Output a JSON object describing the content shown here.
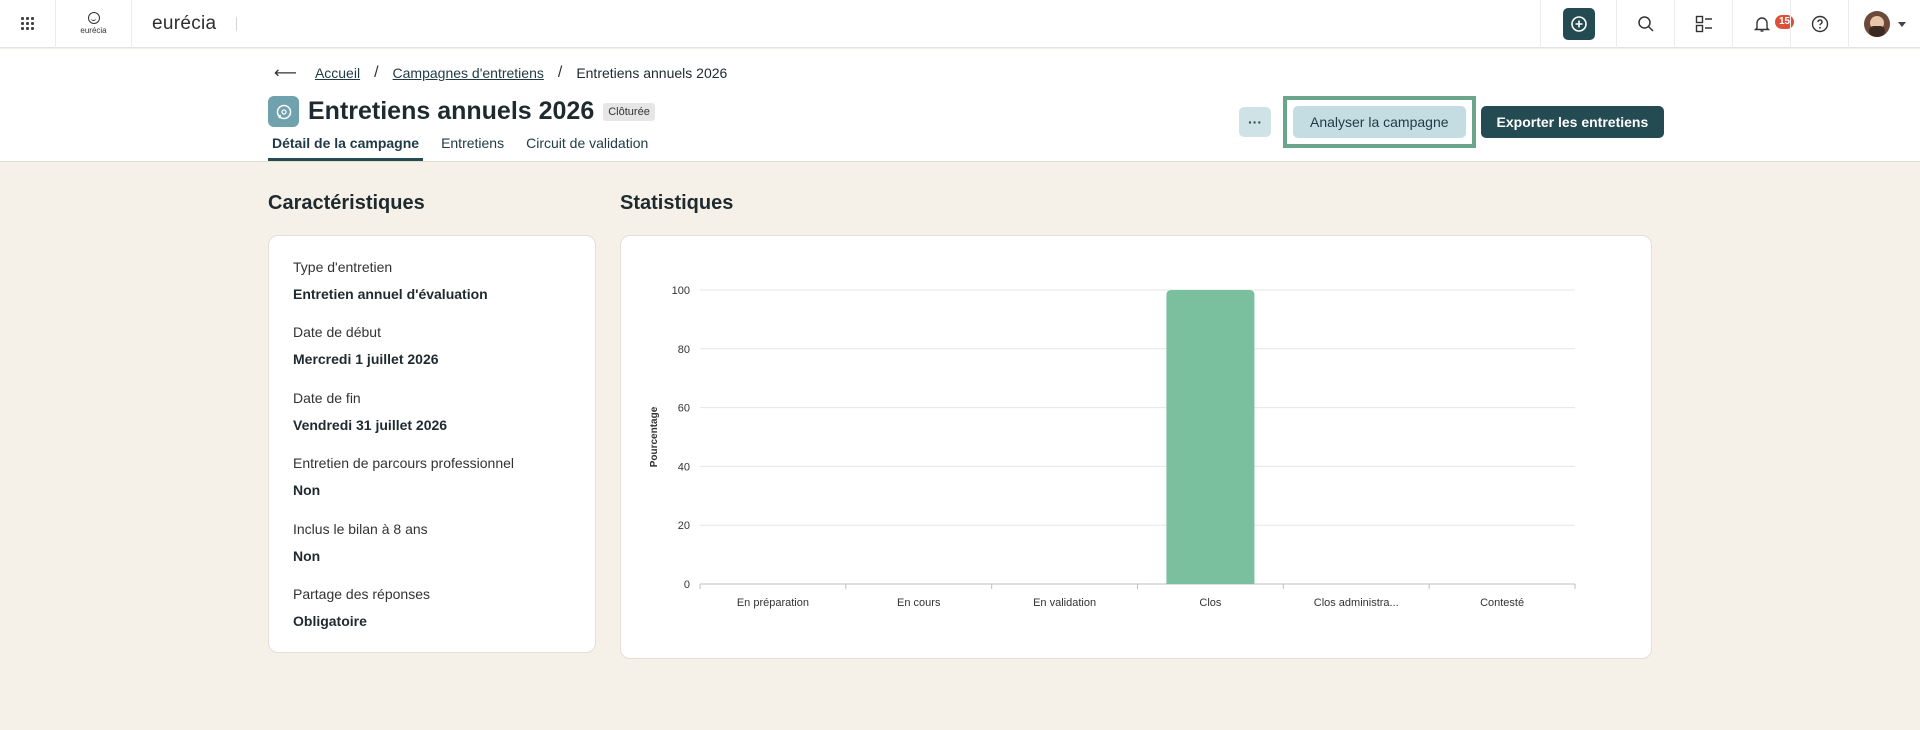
{
  "topbar": {
    "logo_small_text": "eurécia",
    "brand": "eurécia",
    "notifications_count": "15"
  },
  "breadcrumb": {
    "items": [
      "Accueil",
      "Campagnes d'entretiens",
      "Entretiens annuels 2026"
    ]
  },
  "page": {
    "title": "Entretiens annuels 2026",
    "status": "Clôturée",
    "more_label": "···",
    "analyse_label": "Analyser la campagne",
    "export_label": "Exporter les entretiens"
  },
  "tabs": [
    "Détail de la campagne",
    "Entretiens",
    "Circuit de validation"
  ],
  "characteristics": {
    "title": "Caractéristiques",
    "fields": [
      {
        "label": "Type d'entretien",
        "value": "Entretien annuel d'évaluation"
      },
      {
        "label": "Date de début",
        "value": "Mercredi 1 juillet 2026"
      },
      {
        "label": "Date de fin",
        "value": "Vendredi 31 juillet 2026"
      },
      {
        "label": "Entretien de parcours professionnel",
        "value": "Non"
      },
      {
        "label": "Inclus le bilan à 8 ans",
        "value": "Non"
      },
      {
        "label": "Partage des réponses",
        "value": "Obligatoire"
      }
    ]
  },
  "statistics": {
    "title": "Statistiques"
  },
  "colors": {
    "bar": "#7abf9e",
    "primary": "#244a52",
    "highlight": "#6aa58c",
    "badge": "#d9513a"
  },
  "chart_data": {
    "type": "bar",
    "categories": [
      "En préparation",
      "En cours",
      "En validation",
      "Clos",
      "Clos administra...",
      "Contesté"
    ],
    "values": [
      0,
      0,
      0,
      100,
      0,
      0
    ],
    "ylabel": "Pourcentage",
    "xlabel": "",
    "ylim": [
      0,
      100
    ],
    "yticks": [
      0,
      20,
      40,
      60,
      80,
      100
    ],
    "grid": true
  }
}
